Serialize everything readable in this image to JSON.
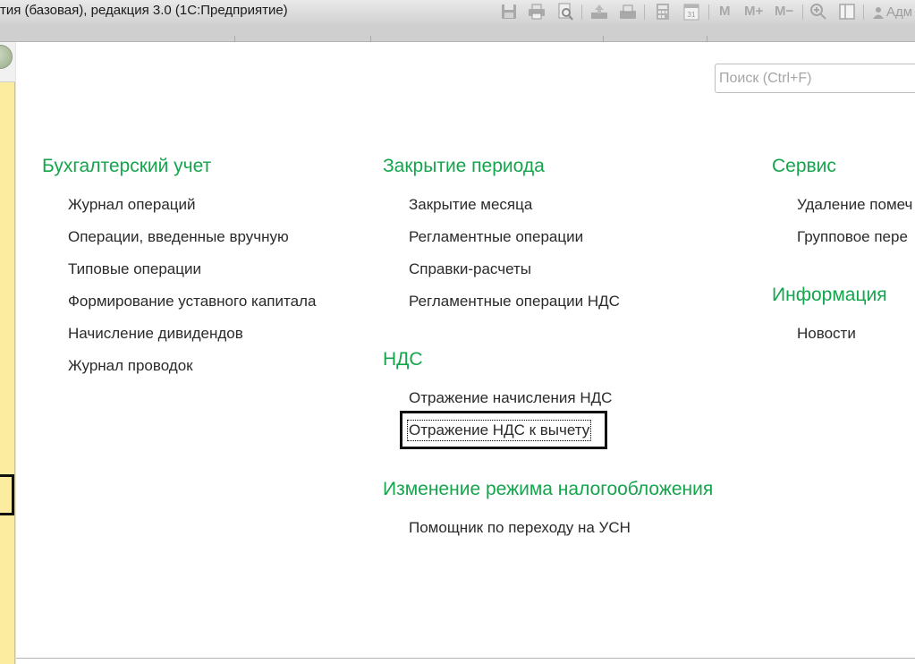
{
  "window": {
    "title": "тия (базовая), редакция 3.0  (1С:Предприятие)",
    "user_label": "Адм"
  },
  "toolbar": {
    "icons": [
      "save-icon",
      "print-icon",
      "print-preview-icon",
      "upload-icon",
      "scanner-icon",
      "calculator-icon",
      "calendar-icon"
    ],
    "calendar_day": "31",
    "memory_labels": [
      "M",
      "M+",
      "M−"
    ]
  },
  "search": {
    "placeholder": "Поиск (Ctrl+F)"
  },
  "sections": {
    "accounting": {
      "title": "Бухгалтерский учет",
      "items": [
        "Журнал операций",
        "Операции, введенные вручную",
        "Типовые операции",
        "Формирование уставного капитала",
        "Начисление дивидендов",
        "Журнал проводок"
      ]
    },
    "period_close": {
      "title": "Закрытие периода",
      "items": [
        "Закрытие месяца",
        "Регламентные операции",
        "Справки-расчеты",
        "Регламентные операции НДС"
      ]
    },
    "vat": {
      "title": "НДС",
      "items": [
        "Отражение начисления НДС",
        "Отражение НДС к вычету"
      ]
    },
    "tax_mode": {
      "title": "Изменение режима налогообложения",
      "items": [
        "Помощник по переходу на УСН"
      ]
    },
    "service": {
      "title": "Сервис",
      "items": [
        "Удаление помеч",
        "Групповое пере"
      ]
    },
    "info": {
      "title": "Информация",
      "items": [
        "Новости"
      ]
    }
  },
  "colors": {
    "group_title": "#15a54d",
    "side_panel": "#fbec9f",
    "link_text": "#2a2a2a"
  }
}
